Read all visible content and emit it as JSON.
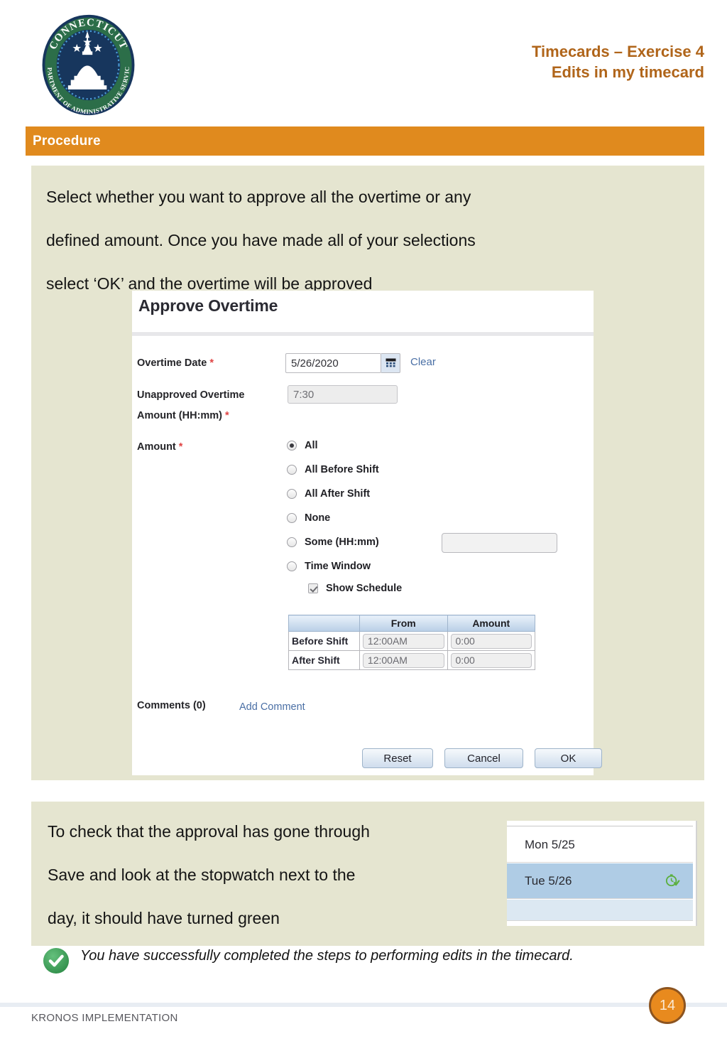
{
  "header": {
    "title_line1": "Timecards – Exercise 4",
    "title_line2": "Edits in my timecard",
    "seal_top_text": "CONNECTICUT",
    "seal_bottom_text": "DEPARTMENT OF ADMINISTRATIVE SERVICES",
    "title_color": "#B0651A"
  },
  "section_bar": {
    "label": "Procedure",
    "color": "#E08A1E"
  },
  "panel_a": {
    "line1": "Select whether you want to approve all the overtime or any",
    "line2": "defined amount. Once you have made all of your selections",
    "line3": "select ‘OK’ and the overtime will be approved"
  },
  "dialog": {
    "title": "Approve Overtime",
    "fields": {
      "overtime_date_label": "Overtime Date",
      "overtime_date_value": "5/26/2020",
      "clear_link": "Clear",
      "unapproved_label_line1": "Unapproved Overtime",
      "unapproved_label_line2": "Amount (HH:mm)",
      "unapproved_value": "7:30",
      "amount_label": "Amount",
      "required_marker": "*"
    },
    "radios": [
      {
        "label": "All",
        "checked": true
      },
      {
        "label": "All Before Shift",
        "checked": false
      },
      {
        "label": "All After Shift",
        "checked": false
      },
      {
        "label": "None",
        "checked": false
      },
      {
        "label": "Some (HH:mm)",
        "checked": false
      },
      {
        "label": "Time Window",
        "checked": false
      }
    ],
    "some_value": "",
    "show_schedule": {
      "label": "Show Schedule",
      "checked": true
    },
    "schedule_table": {
      "headers": [
        "",
        "From",
        "Amount"
      ],
      "rows": [
        {
          "label": "Before Shift",
          "from": "12:00AM",
          "amount": "0:00"
        },
        {
          "label": "After Shift",
          "from": "12:00AM",
          "amount": "0:00"
        }
      ]
    },
    "comments_label": "Comments (0)",
    "add_comment_link": "Add Comment",
    "buttons": {
      "reset": "Reset",
      "cancel": "Cancel",
      "ok": "OK"
    }
  },
  "panel_b": {
    "line1": "To check that the approval has gone through",
    "line2": "Save and look at the stopwatch next to the",
    "line3": "day, it should have turned green"
  },
  "timecard_widget": {
    "row1": "Mon 5/25",
    "row2": "Tue 5/26",
    "highlight_color": "#AFCCE5",
    "stopwatch_color": "#5BAF3E"
  },
  "success": {
    "icon": "check-circle-icon",
    "text": "You have successfully completed the steps to performing edits in the timecard.",
    "icon_color": "#3C9B52"
  },
  "footer": {
    "text": "KRONOS IMPLEMENTATION",
    "page_number": "14",
    "badge_color": "#E88A1E"
  }
}
